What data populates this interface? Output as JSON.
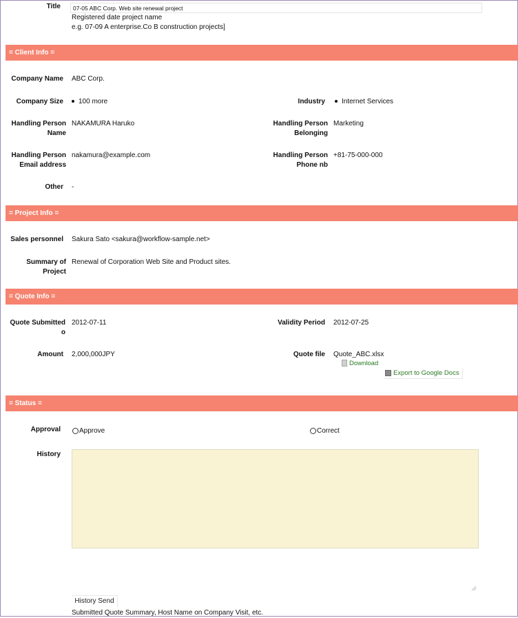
{
  "title": {
    "label": "Title",
    "value": "07-05 ABC Corp. Web site renewal project",
    "hint_line1": "Registered date project name",
    "hint_line2": "e.g. 07-09 A enterprise.Co B construction projects]"
  },
  "sections": {
    "client": "= Client Info =",
    "project": "= Project Info =",
    "quote": "= Quote Info =",
    "status": "= Status ="
  },
  "client": {
    "company_name": {
      "label": "Company Name",
      "value": "ABC Corp."
    },
    "company_size": {
      "label": "Company Size",
      "value": "100 more"
    },
    "industry": {
      "label": "Industry",
      "value": "Internet Services"
    },
    "handling_person_name": {
      "label_line1": "Handling Person",
      "label_line2": "Name",
      "value": "NAKAMURA Haruko"
    },
    "handling_person_belonging": {
      "label_line1": "Handling Person",
      "label_line2": "Belonging",
      "value": "Marketing"
    },
    "handling_person_email": {
      "label_line1": "Handling Person",
      "label_line2": "Email address",
      "value": "nakamura@example.com"
    },
    "handling_person_phone": {
      "label_line1": "Handling Person",
      "label_line2": "Phone nb",
      "value": "+81-75-000-000"
    },
    "other": {
      "label": "Other",
      "value": "-"
    }
  },
  "project": {
    "sales_personnel": {
      "label": "Sales personnel",
      "value": "Sakura Sato <sakura@workflow-sample.net>"
    },
    "summary": {
      "label_line1": "Summary of",
      "label_line2": "Project",
      "value": "Renewal of Corporation Web Site and Product sites."
    }
  },
  "quote": {
    "submitted": {
      "label_line1": "Quote Submitted",
      "label_line2": "o",
      "value": "2012-07-11"
    },
    "validity": {
      "label": "Validity Period",
      "value": "2012-07-25"
    },
    "amount": {
      "label": "Amount",
      "value": "2,000,000JPY"
    },
    "file": {
      "label": "Quote file",
      "value": "Quote_ABC.xlsx",
      "download": "Download",
      "export": "Export to Google Docs"
    }
  },
  "status": {
    "approval_label": "Approval",
    "approve_option": "Approve",
    "correct_option": "Correct",
    "history_label": "History",
    "history_send": "History Send",
    "footer_note": "Submitted Quote Summary, Host Name on Company Visit, etc."
  },
  "colors": {
    "section_band": "#f5836f",
    "history_bg": "#f9f3d4",
    "link_green": "#2a7a22"
  }
}
